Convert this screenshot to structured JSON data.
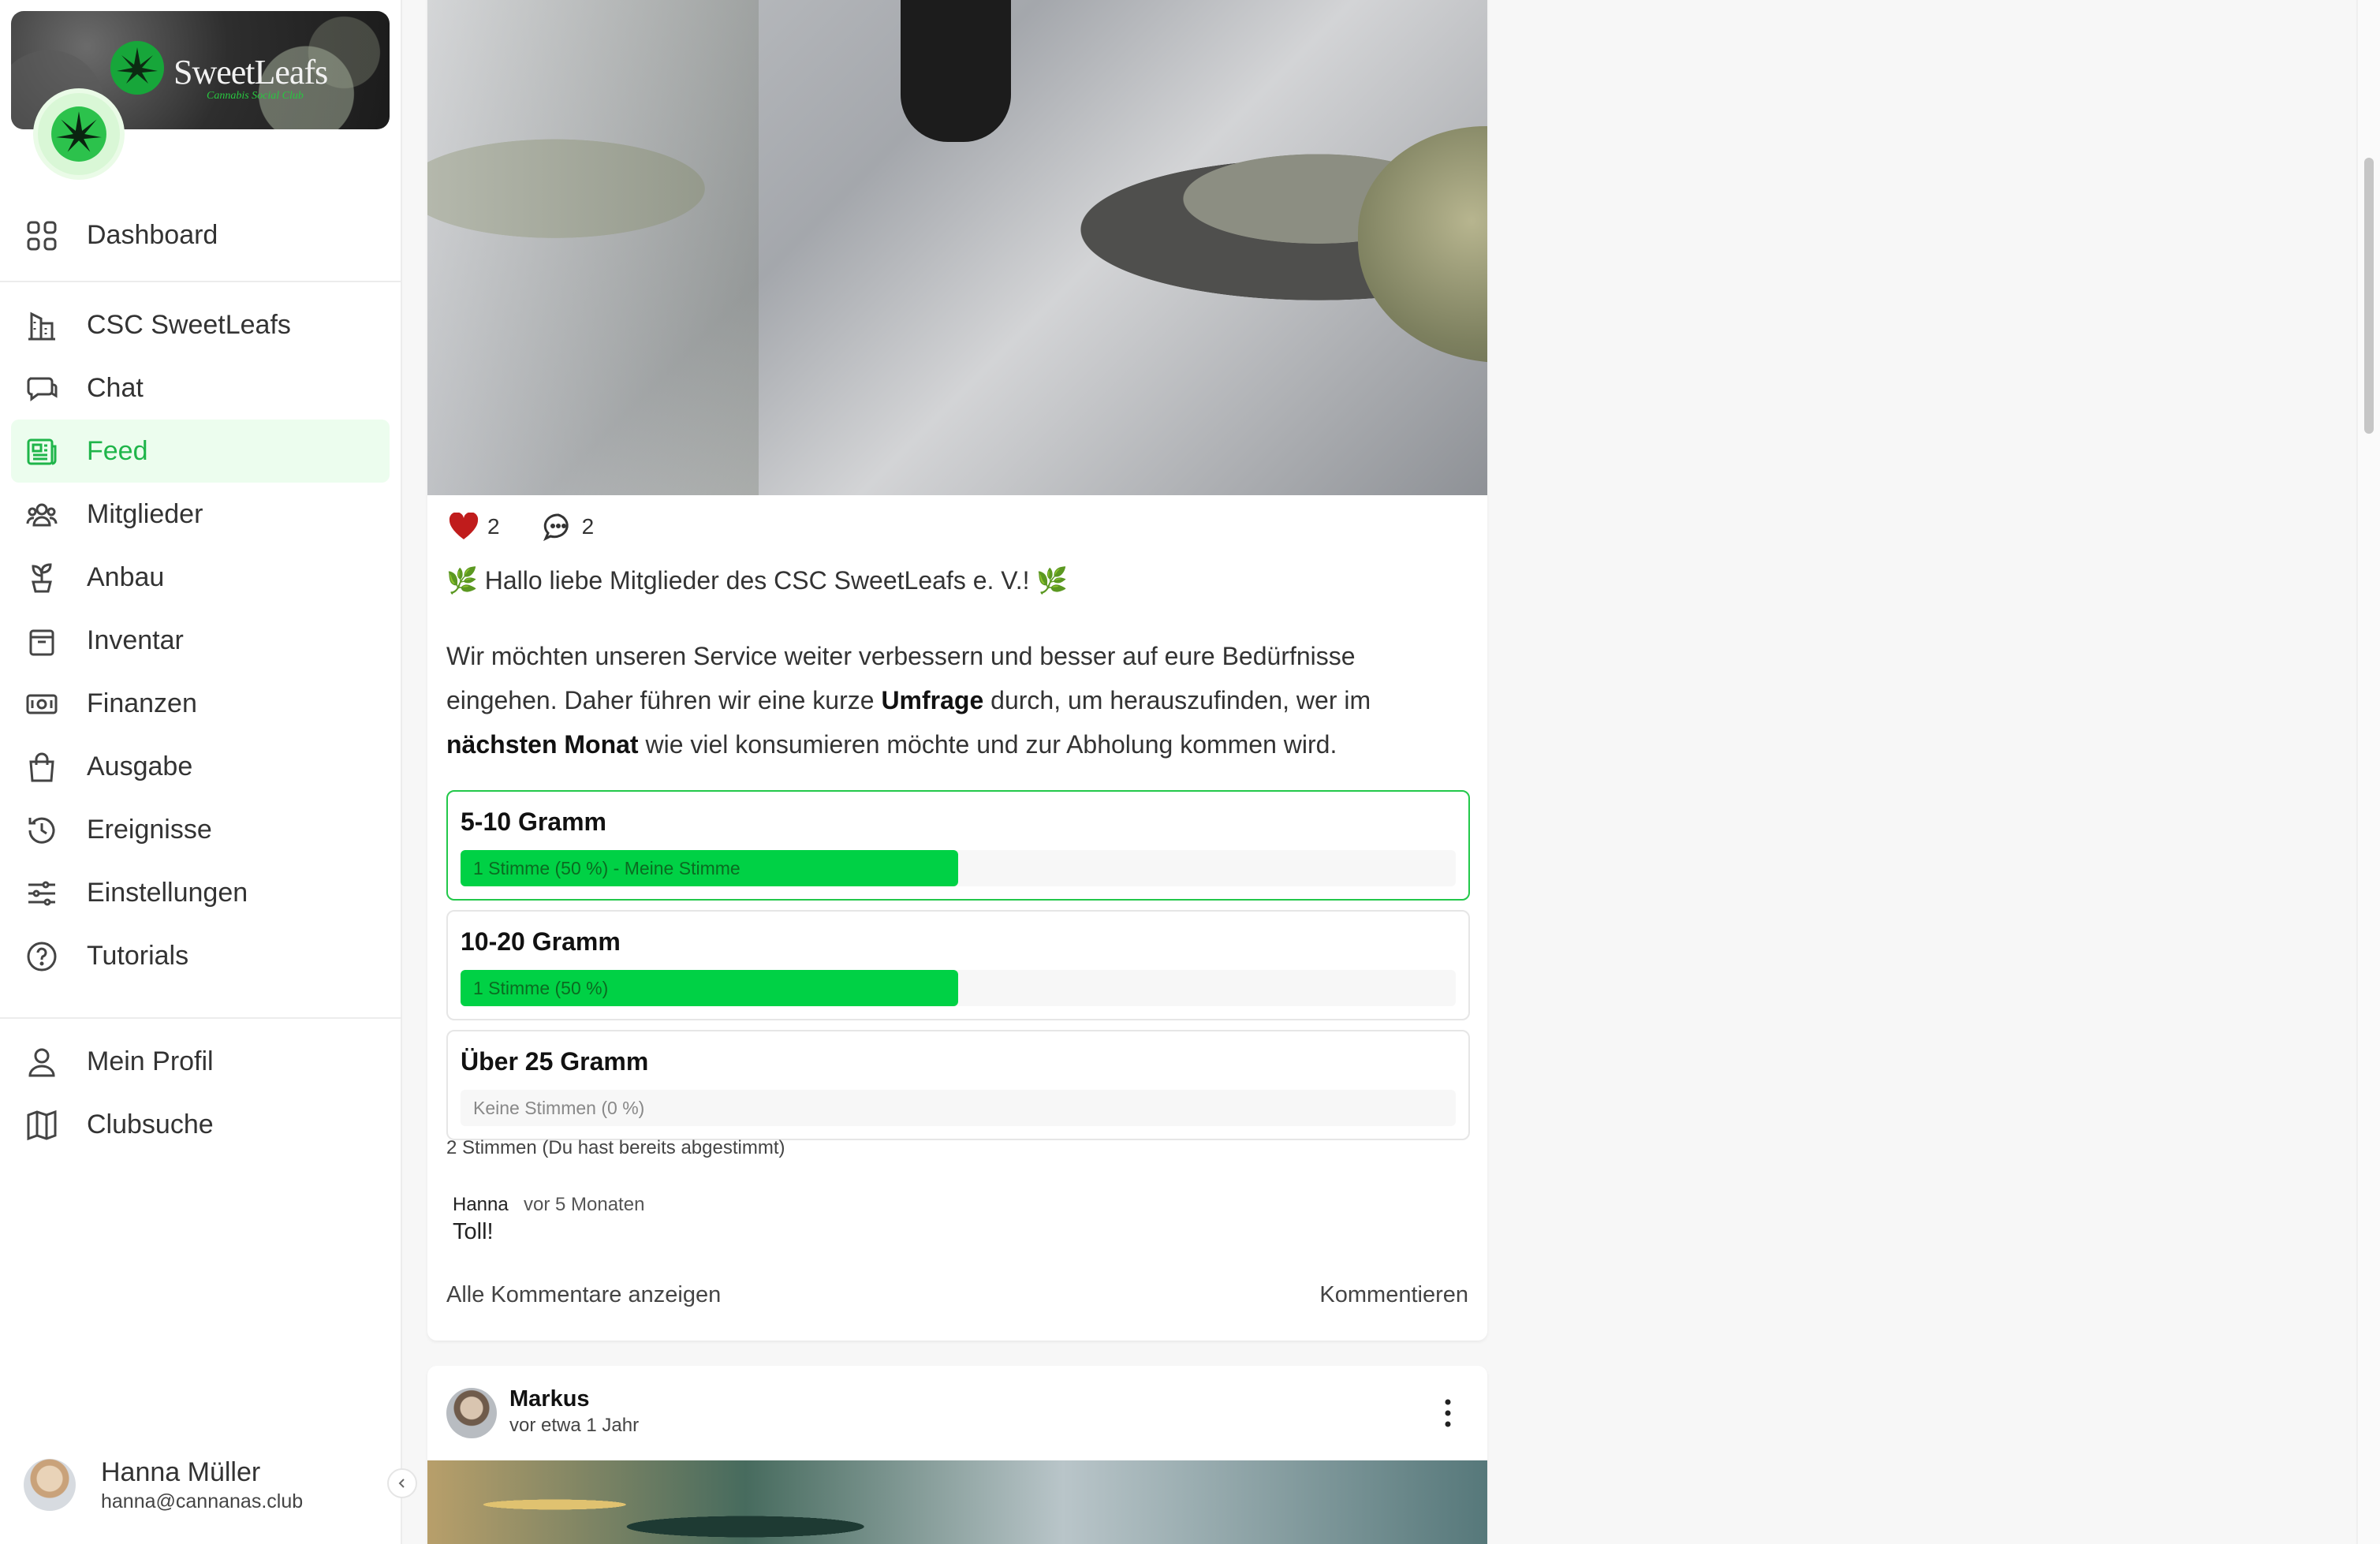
{
  "club": {
    "brand": "SweetLeafs",
    "subtitle": "Cannabis Social Club"
  },
  "nav": {
    "dashboard": "Dashboard",
    "items": [
      {
        "label": "CSC SweetLeafs",
        "icon": "building-icon"
      },
      {
        "label": "Chat",
        "icon": "chat-icon"
      },
      {
        "label": "Feed",
        "icon": "newspaper-icon",
        "active": true
      },
      {
        "label": "Mitglieder",
        "icon": "users-icon"
      },
      {
        "label": "Anbau",
        "icon": "plant-icon"
      },
      {
        "label": "Inventar",
        "icon": "box-icon"
      },
      {
        "label": "Finanzen",
        "icon": "money-icon"
      },
      {
        "label": "Ausgabe",
        "icon": "bag-icon"
      },
      {
        "label": "Ereignisse",
        "icon": "history-icon"
      },
      {
        "label": "Einstellungen",
        "icon": "sliders-icon"
      },
      {
        "label": "Tutorials",
        "icon": "help-icon"
      }
    ],
    "profile": "Mein Profil",
    "clubsearch": "Clubsuche"
  },
  "user": {
    "name": "Hanna Müller",
    "email": "hanna@cannanas.club"
  },
  "post1": {
    "likes": "2",
    "comments": "2",
    "greeting": "Hallo liebe Mitglieder des CSC SweetLeafs e. V.!",
    "body_a": "Wir möchten unseren Service weiter verbessern und besser auf eure Bedürfnisse eingehen. Daher führen wir eine kurze ",
    "body_b": "Umfrage",
    "body_c": " durch, um herauszufinden, wer im ",
    "body_d": "nächsten Monat",
    "body_e": " wie viel konsumieren möchte und zur Abholung kommen wird.",
    "poll": [
      {
        "label": "5-10 Gramm",
        "result": "1 Stimme (50 %) - Meine Stimme",
        "share": 0.5,
        "selected": true
      },
      {
        "label": "10-20 Gramm",
        "result": "1 Stimme (50 %)",
        "share": 0.5,
        "selected": false
      },
      {
        "label": "Über 25 Gramm",
        "result": "Keine Stimmen (0 %)",
        "share": 0,
        "selected": false
      }
    ],
    "poll_summary": "2 Stimmen (Du hast bereits abgestimmt)",
    "comment": {
      "author": "Hanna",
      "time": "vor 5 Monaten",
      "text": "Toll!"
    },
    "show_all_comments": "Alle Kommentare anzeigen",
    "comment_action": "Kommentieren"
  },
  "post2": {
    "author": "Markus",
    "time": "vor etwa 1 Jahr"
  },
  "colors": {
    "accent": "#1fb54a",
    "poll_fill": "#00d145",
    "heart": "#c01c1c"
  }
}
